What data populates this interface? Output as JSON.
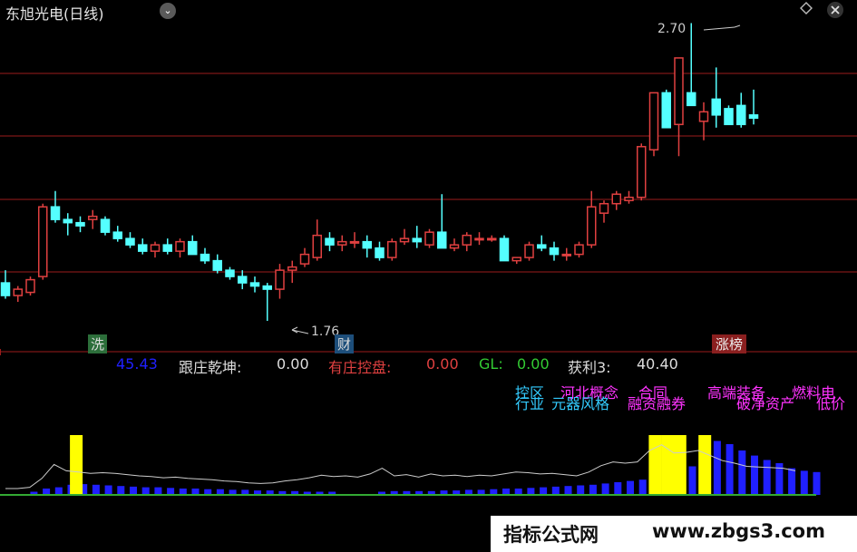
{
  "header": {
    "title": "东旭光电(日线)"
  },
  "price_labels": {
    "high": "2.70",
    "low": "1.76"
  },
  "tags": {
    "green": "洗",
    "cai": "财",
    "zhangbang": "涨榜"
  },
  "indicators": {
    "value1": "45.43",
    "genzhuang_label": "跟庄乾坤:",
    "genzhuang_value": "0.00",
    "youzhuang_label": "有庄控盘:",
    "youzhuang_value": "0.00",
    "gl_label": "GL:",
    "gl_value": "0.00",
    "huoli_label": "获利3:",
    "huoli_value": "40.40"
  },
  "overlay_text": {
    "line1_a": "控区",
    "line1_b": "河北概念",
    "line1_c": "合同",
    "line1_d": "高端装备",
    "line1_e": "燃料电",
    "line2_a": "行业",
    "line2_b": "元器风格",
    "line2_c": "融资融券",
    "line2_d": "破净资产",
    "line2_e": "低价"
  },
  "watermark": {
    "cn": "指标公式网",
    "url": "www.zbgs3.com"
  },
  "colors": {
    "up": "#e04040",
    "down": "#54ffff",
    "blue": "#2020ff",
    "yellow": "#ffff00",
    "grid": "#9b1c1c",
    "line": "#cccccc",
    "magenta": "#ff33ff",
    "cyan": "#33ccff"
  },
  "chart_data": {
    "type": "candlestick",
    "ohlc": [
      [
        1.88,
        1.92,
        1.83,
        1.84
      ],
      [
        1.84,
        1.87,
        1.82,
        1.86
      ],
      [
        1.85,
        1.9,
        1.84,
        1.89
      ],
      [
        1.9,
        2.13,
        1.89,
        2.12
      ],
      [
        2.12,
        2.17,
        2.07,
        2.08
      ],
      [
        2.08,
        2.1,
        2.03,
        2.07
      ],
      [
        2.07,
        2.09,
        2.04,
        2.06
      ],
      [
        2.08,
        2.11,
        2.05,
        2.09
      ],
      [
        2.08,
        2.09,
        2.03,
        2.04
      ],
      [
        2.04,
        2.06,
        2.01,
        2.02
      ],
      [
        2.02,
        2.04,
        1.99,
        2.0
      ],
      [
        2.0,
        2.02,
        1.97,
        1.98
      ],
      [
        1.98,
        2.01,
        1.96,
        2.0
      ],
      [
        2.0,
        2.02,
        1.97,
        1.98
      ],
      [
        1.98,
        2.02,
        1.96,
        2.01
      ],
      [
        2.01,
        2.03,
        1.97,
        1.97
      ],
      [
        1.97,
        1.99,
        1.94,
        1.95
      ],
      [
        1.95,
        1.97,
        1.91,
        1.92
      ],
      [
        1.92,
        1.93,
        1.89,
        1.9
      ],
      [
        1.9,
        1.92,
        1.86,
        1.88
      ],
      [
        1.88,
        1.9,
        1.85,
        1.87
      ],
      [
        1.87,
        1.88,
        1.76,
        1.86
      ],
      [
        1.86,
        1.94,
        1.83,
        1.92
      ],
      [
        1.92,
        1.95,
        1.88,
        1.93
      ],
      [
        1.94,
        1.99,
        1.93,
        1.97
      ],
      [
        1.96,
        2.08,
        1.95,
        2.03
      ],
      [
        2.02,
        2.04,
        1.98,
        2.0
      ],
      [
        2.0,
        2.03,
        1.98,
        2.01
      ],
      [
        2.01,
        2.04,
        1.99,
        2.01
      ],
      [
        2.01,
        2.03,
        1.96,
        1.99
      ],
      [
        1.99,
        2.01,
        1.95,
        1.96
      ],
      [
        1.96,
        2.02,
        1.95,
        2.01
      ],
      [
        2.01,
        2.05,
        2.0,
        2.02
      ],
      [
        2.02,
        2.06,
        1.99,
        2.01
      ],
      [
        2.0,
        2.05,
        1.99,
        2.04
      ],
      [
        2.04,
        2.16,
        1.99,
        1.99
      ],
      [
        1.99,
        2.02,
        1.98,
        2.0
      ],
      [
        2.0,
        2.04,
        1.98,
        2.03
      ],
      [
        2.02,
        2.04,
        2.0,
        2.02
      ],
      [
        2.02,
        2.03,
        2.01,
        2.02
      ],
      [
        2.02,
        2.03,
        1.95,
        1.95
      ],
      [
        1.95,
        1.96,
        1.94,
        1.96
      ],
      [
        1.96,
        2.01,
        1.95,
        2.0
      ],
      [
        2.0,
        2.03,
        1.98,
        1.99
      ],
      [
        1.99,
        2.01,
        1.95,
        1.97
      ],
      [
        1.97,
        1.99,
        1.95,
        1.97
      ],
      [
        1.97,
        2.01,
        1.96,
        2.0
      ],
      [
        2.0,
        2.17,
        1.99,
        2.12
      ],
      [
        2.1,
        2.14,
        2.07,
        2.13
      ],
      [
        2.13,
        2.17,
        2.11,
        2.16
      ],
      [
        2.14,
        2.17,
        2.13,
        2.15
      ],
      [
        2.15,
        2.32,
        2.14,
        2.31
      ],
      [
        2.3,
        2.48,
        2.28,
        2.48
      ],
      [
        2.48,
        2.49,
        2.42,
        2.37
      ],
      [
        2.38,
        2.59,
        2.28,
        2.59
      ],
      [
        2.48,
        2.7,
        2.47,
        2.44
      ],
      [
        2.39,
        2.45,
        2.33,
        2.42
      ],
      [
        2.46,
        2.56,
        2.37,
        2.41
      ],
      [
        2.43,
        2.44,
        2.39,
        2.38
      ],
      [
        2.44,
        2.48,
        2.37,
        2.38
      ],
      [
        2.41,
        2.49,
        2.38,
        2.4
      ]
    ],
    "vol_line": [
      0.1,
      0.1,
      0.12,
      0.26,
      0.48,
      0.38,
      0.36,
      0.34,
      0.35,
      0.34,
      0.32,
      0.3,
      0.29,
      0.27,
      0.28,
      0.26,
      0.25,
      0.24,
      0.22,
      0.21,
      0.19,
      0.18,
      0.19,
      0.22,
      0.24,
      0.27,
      0.31,
      0.29,
      0.3,
      0.28,
      0.33,
      0.42,
      0.3,
      0.32,
      0.28,
      0.33,
      0.3,
      0.31,
      0.29,
      0.31,
      0.3,
      0.33,
      0.36,
      0.35,
      0.33,
      0.34,
      0.32,
      0.3,
      0.36,
      0.46,
      0.52,
      0.5,
      0.52,
      0.7,
      0.79,
      0.66,
      0.67,
      0.7,
      0.62,
      0.54,
      0.5,
      0.45,
      0.44,
      0.43,
      0.42,
      0.38
    ],
    "bars": [
      0,
      0,
      0.05,
      0.1,
      0.12,
      0.16,
      0.17,
      0.16,
      0.15,
      0.14,
      0.13,
      0.12,
      0.12,
      0.11,
      0.1,
      0.1,
      0.09,
      0.09,
      0.08,
      0.08,
      0.07,
      0.07,
      0.06,
      0.06,
      0.05,
      0.05,
      0.05,
      0,
      0,
      0,
      0.05,
      0.06,
      0.06,
      0.06,
      0.06,
      0.07,
      0.07,
      0.08,
      0.08,
      0.09,
      0.1,
      0.1,
      0.11,
      0.12,
      0.13,
      0.14,
      0.15,
      0.16,
      0.18,
      0.2,
      0.22,
      0.24,
      0.32,
      0.34,
      0.38,
      0.45,
      0.62,
      0.85,
      0.8,
      0.7,
      0.62,
      0.55,
      0.5,
      0.42,
      0.38,
      0.36
    ],
    "yellow_bars": [
      3,
      52,
      53,
      54,
      56
    ],
    "ylim": [
      1.7,
      2.75
    ]
  }
}
